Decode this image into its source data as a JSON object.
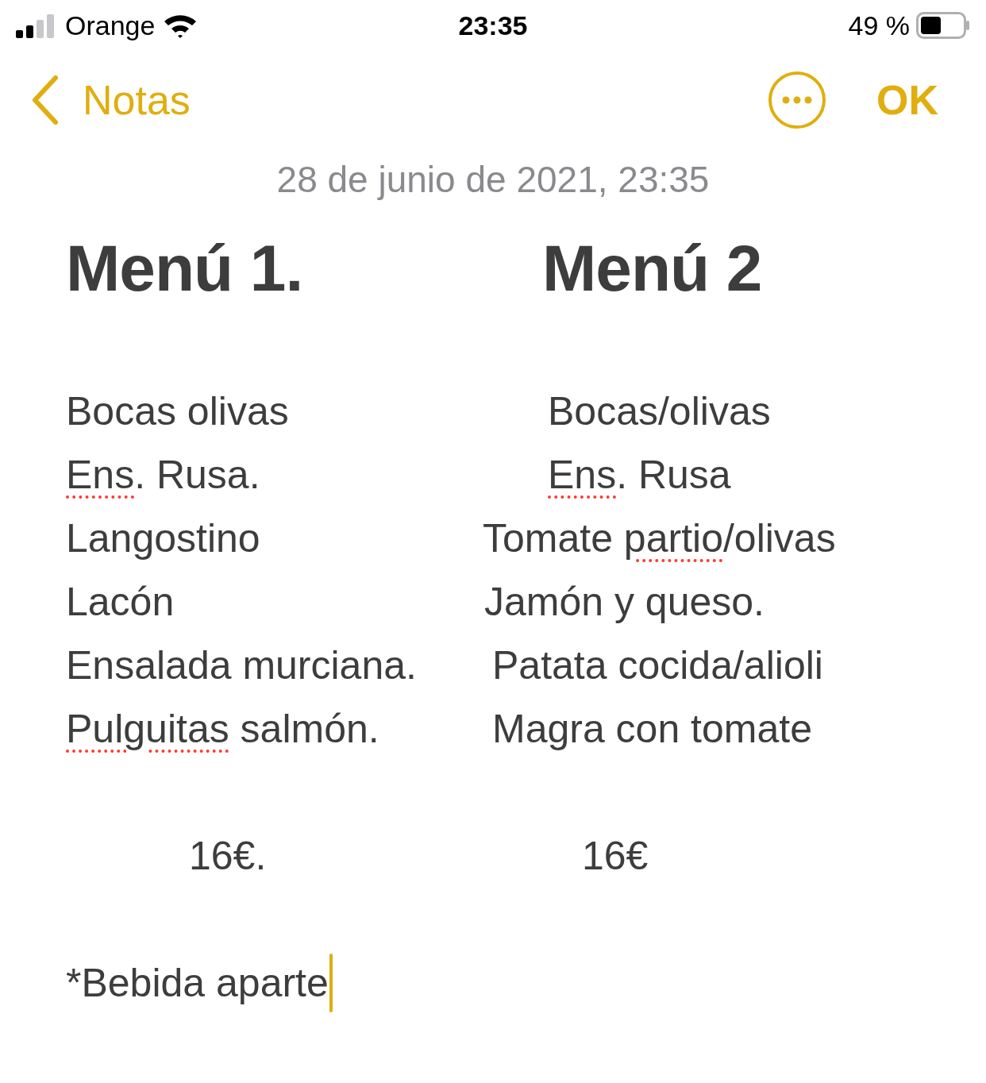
{
  "status_bar": {
    "carrier": "Orange",
    "time": "23:35",
    "battery": "49 %"
  },
  "nav": {
    "back": "Notas",
    "done": "OK"
  },
  "note": {
    "date": "28 de junio de 2021, 23:35",
    "headings": [
      "Menú 1.",
      "Menú 2"
    ],
    "rows": [
      {
        "left": [
          {
            "text": "Bocas olivas",
            "misspelled": false
          }
        ],
        "right": [
          {
            "text": "Bocas/olivas",
            "misspelled": false
          }
        ]
      },
      {
        "left": [
          {
            "text": "Ens",
            "misspelled": true
          },
          {
            "text": ". Rusa.",
            "misspelled": false
          }
        ],
        "right": [
          {
            "text": "Ens",
            "misspelled": true
          },
          {
            "text": ". Rusa",
            "misspelled": false
          }
        ]
      },
      {
        "left": [
          {
            "text": "Langostino",
            "misspelled": false
          }
        ],
        "right": [
          {
            "text": "Tomate ",
            "misspelled": false
          },
          {
            "text": "partio",
            "misspelled": true
          },
          {
            "text": "/olivas",
            "misspelled": false
          }
        ]
      },
      {
        "left": [
          {
            "text": "Lacón",
            "misspelled": false
          }
        ],
        "right": [
          {
            "text": "Jamón y queso.",
            "misspelled": false
          }
        ]
      },
      {
        "left": [
          {
            "text": "Ensalada murciana.",
            "misspelled": false
          }
        ],
        "right": [
          {
            "text": "Patata cocida/alioli",
            "misspelled": false
          }
        ]
      },
      {
        "left": [
          {
            "text": "Pulguitas",
            "misspelled": true
          },
          {
            "text": " salmón.",
            "misspelled": false
          }
        ],
        "right": [
          {
            "text": "Magra con tomate",
            "misspelled": false
          }
        ]
      }
    ],
    "prices": [
      "16€.",
      "16€"
    ],
    "footnote": "*Bebida aparte"
  }
}
